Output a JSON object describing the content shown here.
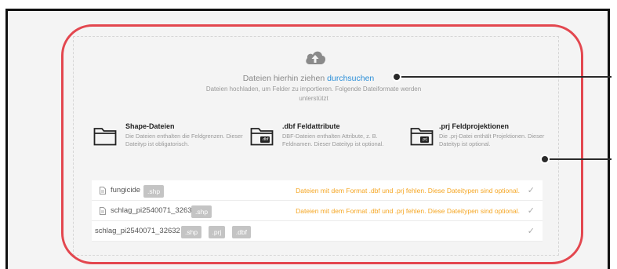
{
  "upload": {
    "icon": "cloud-upload-icon",
    "drag_text": "Dateien hierhin ziehen",
    "browse_link": "durchsuchen",
    "subtitle": "Dateien hochladen, um Felder zu importieren. Folgende Dateiformate werden unterstützt"
  },
  "file_types": [
    {
      "icon": "folder-icon",
      "title": "Shape-Dateien",
      "description": "Die Dateien enthalten die Feldgrenzen. Dieser Dateityp ist obligatorisch."
    },
    {
      "icon": "folder-dbf-icon",
      "tag": ".dbf",
      "title": ".dbf Feldattribute",
      "description": "DBF-Dateien enthalten Attribute, z. B. Feldnamen. Dieser Dateityp ist optional."
    },
    {
      "icon": "folder-prj-icon",
      "tag": ".prj",
      "title": ".prj Feldprojektionen",
      "description": "Die .prj-Datei enthält Projektionen. Dieser Dateityp ist optional."
    }
  ],
  "files": [
    {
      "name": "fungicide",
      "badges": [
        ".shp"
      ],
      "warning": "Dateien mit dem Format .dbf und .prj fehlen. Diese Dateitypen sind optional.",
      "has_icon": true
    },
    {
      "name": "schlag_pi2540071_3263",
      "badges": [
        ".shp"
      ],
      "warning": "Dateien mit dem Format .dbf und .prj fehlen. Diese Dateitypen sind optional.",
      "has_icon": true
    },
    {
      "name": "schlag_pi2540071_32632",
      "badges": [
        ".shp",
        ".prj",
        ".dbf"
      ],
      "warning": "",
      "has_icon": false
    }
  ],
  "check_glyph": "✓",
  "colors": {
    "highlight": "#e3474f",
    "link": "#2b8fd8",
    "warning": "#f5a623",
    "badge": "#c4c4c4"
  }
}
